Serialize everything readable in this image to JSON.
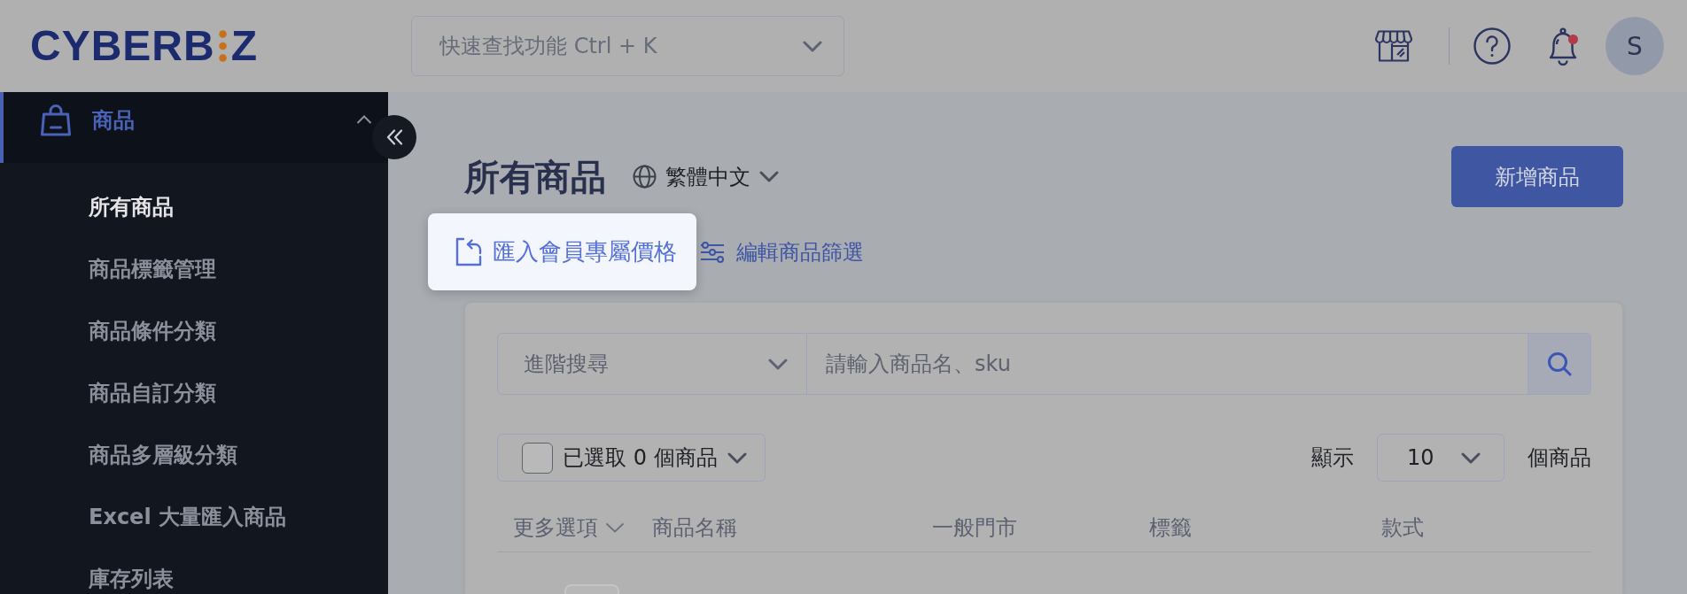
{
  "header": {
    "logo": {
      "left": "CYBERB",
      "right": "Z"
    },
    "quick_search": {
      "placeholder": "快速查找功能 Ctrl + K"
    },
    "notifications": {
      "unread": true
    },
    "avatar": "S"
  },
  "sidebar": {
    "section": {
      "label": "商品",
      "expanded": true,
      "selected": true
    },
    "items": [
      {
        "label": "所有商品",
        "selected": true
      },
      {
        "label": "商品標籤管理",
        "selected": false
      },
      {
        "label": "商品條件分類",
        "selected": false
      },
      {
        "label": "商品自訂分類",
        "selected": false
      },
      {
        "label": "商品多層級分類",
        "selected": false
      },
      {
        "label": "Excel 大量匯入商品",
        "selected": false
      },
      {
        "label": "庫存列表",
        "selected": false
      }
    ]
  },
  "page": {
    "title": "所有商品",
    "language": "繁體中文",
    "primary_button": "新增商品",
    "actions": [
      {
        "kind": "import",
        "label": "匯入會員專屬價格",
        "highlighted": true
      },
      {
        "kind": "filter",
        "label": "編輯商品篩選",
        "highlighted": false
      }
    ]
  },
  "search": {
    "mode": "進階搜尋",
    "placeholder": "請輸入商品名、sku"
  },
  "selection": {
    "checked": false,
    "label": "已選取 0 個商品"
  },
  "page_size": {
    "label": "顯示",
    "value": "10",
    "unit": "個商品"
  },
  "table": {
    "columns": [
      {
        "label": "更多選項",
        "kind": "menu"
      },
      {
        "label": "商品名稱",
        "kind": "text"
      },
      {
        "label": "一般門市",
        "kind": "text"
      },
      {
        "label": "標籤",
        "kind": "text"
      },
      {
        "label": "款式",
        "kind": "text"
      }
    ]
  }
}
